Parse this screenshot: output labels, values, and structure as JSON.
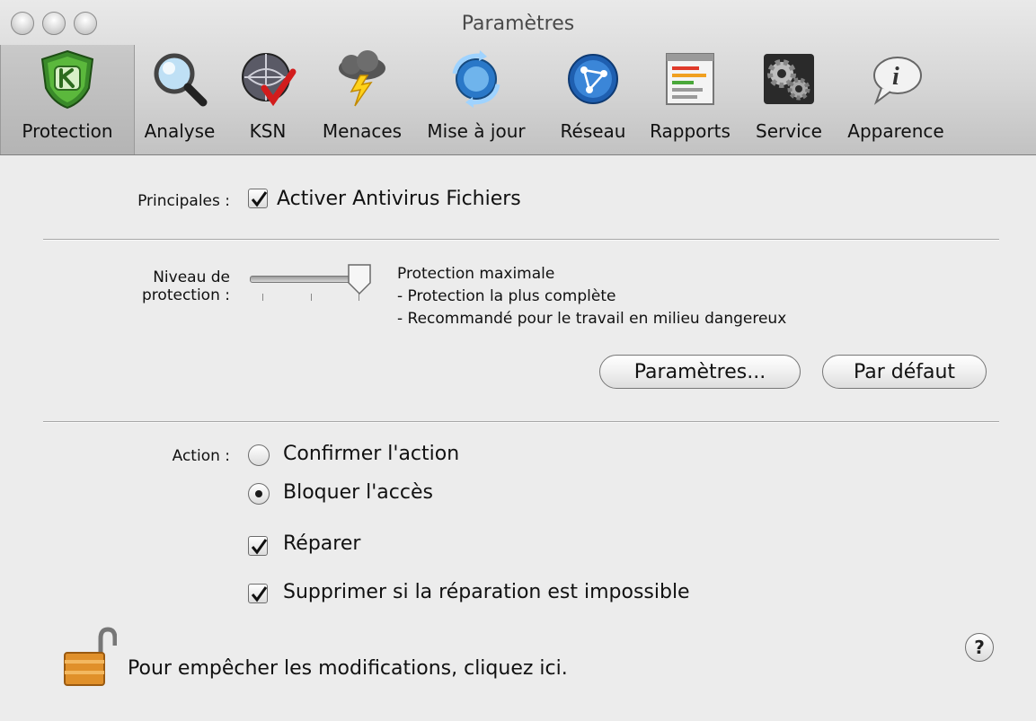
{
  "window": {
    "title": "Paramètres"
  },
  "toolbar": {
    "items": [
      {
        "label": "Protection",
        "icon": "shield-k-icon",
        "selected": true
      },
      {
        "label": "Analyse",
        "icon": "magnifier-icon"
      },
      {
        "label": "KSN",
        "icon": "ksn-globe-icon"
      },
      {
        "label": "Menaces",
        "icon": "storm-cloud-icon"
      },
      {
        "label": "Mise à jour",
        "icon": "update-icon"
      },
      {
        "label": "Réseau",
        "icon": "network-icon"
      },
      {
        "label": "Rapports",
        "icon": "reports-icon"
      },
      {
        "label": "Service",
        "icon": "gears-icon"
      },
      {
        "label": "Apparence",
        "icon": "speech-bubble-icon"
      }
    ]
  },
  "principales": {
    "label": "Principales :",
    "checkbox_label": "Activer Antivirus Fichiers",
    "checked": true
  },
  "protection_level": {
    "label_line1": "Niveau de",
    "label_line2": "protection :",
    "slider_value": 3,
    "slider_max": 3,
    "description_title": "Protection maximale",
    "description_line1": "- Protection la plus complète",
    "description_line2": "- Recommandé pour le travail en milieu dangereux",
    "settings_button": "Paramètres...",
    "default_button": "Par défaut"
  },
  "action": {
    "label": "Action :",
    "radio_confirm": "Confirmer l'action",
    "radio_block": "Bloquer l'accès",
    "selected": "block",
    "repair_label": "Réparer",
    "repair_checked": true,
    "delete_label": "Supprimer si la réparation est impossible",
    "delete_checked": true
  },
  "lock": {
    "text": "Pour empêcher les modifications, cliquez ici."
  },
  "help": {
    "symbol": "?"
  }
}
